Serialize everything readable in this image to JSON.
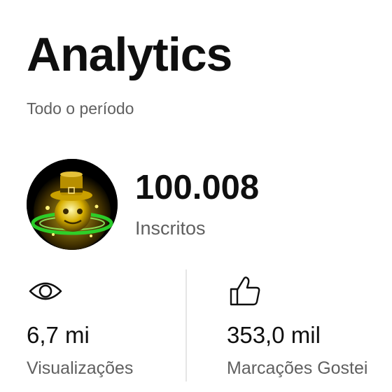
{
  "header": {
    "title": "Analytics",
    "period": "Todo o período"
  },
  "channel": {
    "avatar_icon": "golden-hat-mascot-avatar",
    "subscribers_value": "100.008",
    "subscribers_label": "Inscritos"
  },
  "stats": [
    {
      "icon": "eye-icon",
      "value": "6,7 mi",
      "label": "Visualizações"
    },
    {
      "icon": "thumbs-up-icon",
      "value": "353,0 mil",
      "label": "Marcações Gostei"
    }
  ],
  "colors": {
    "text_primary": "#0f0f0f",
    "text_secondary": "#606060",
    "divider": "#e5e5e5"
  }
}
